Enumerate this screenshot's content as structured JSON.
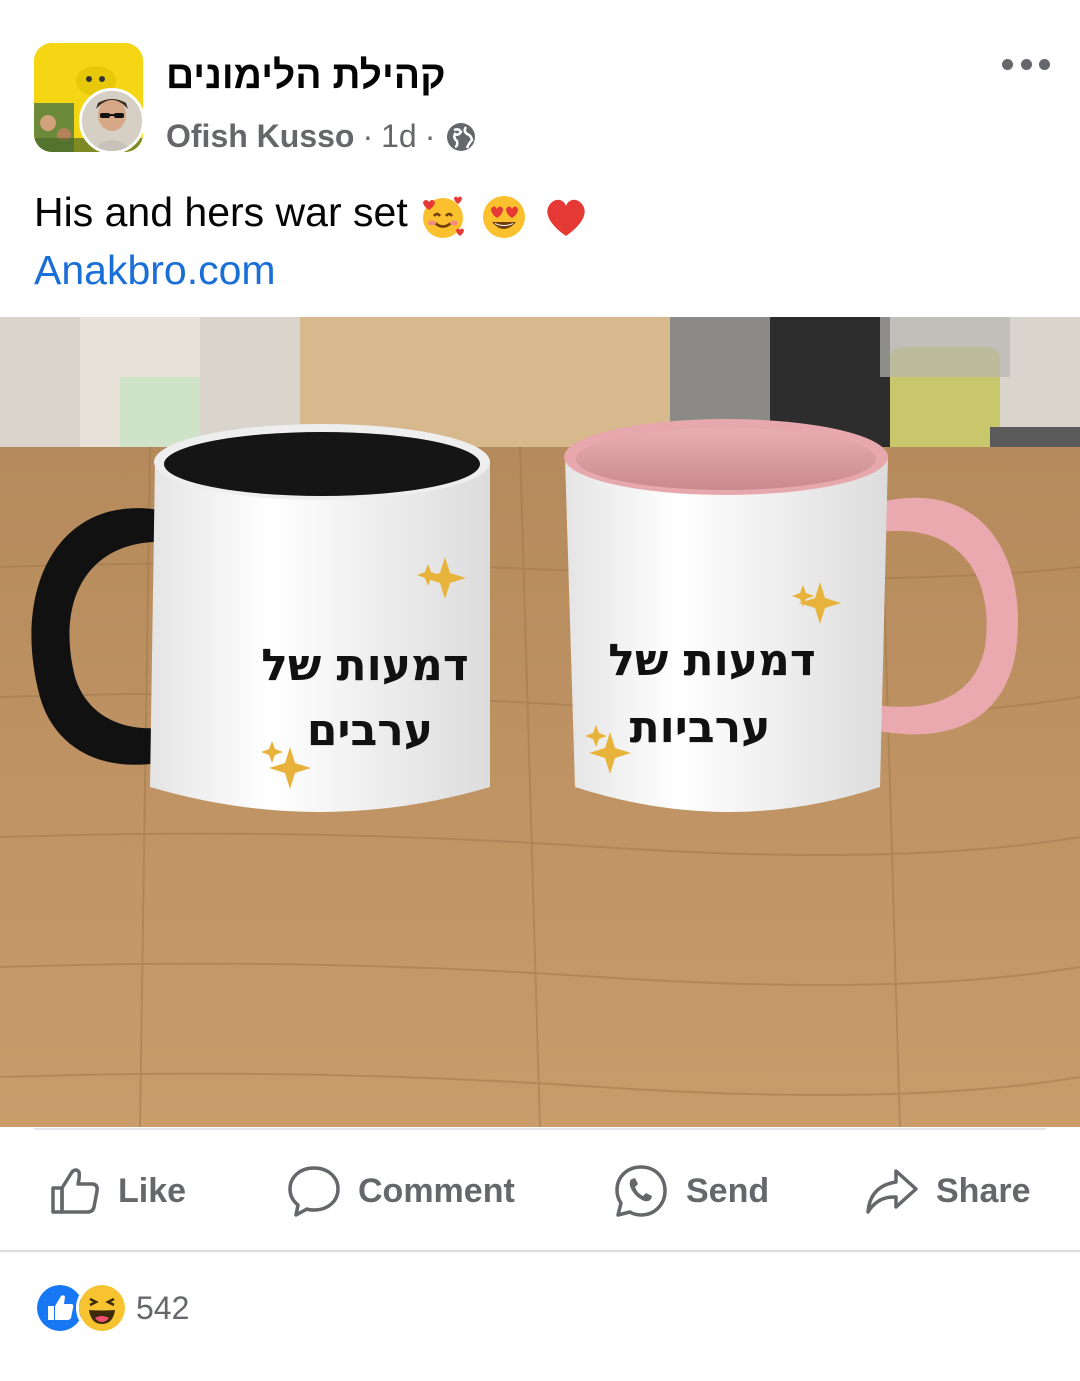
{
  "post": {
    "group_name": "קהילת הלימונים",
    "author": "Ofish Kusso",
    "time": "1d",
    "separator": "·",
    "privacy_icon": "globe-icon",
    "text": "His and hers war set",
    "text_emojis": [
      "smiling-face-with-hearts",
      "heart-eyes",
      "red-heart"
    ],
    "link": "Anakbro.com"
  },
  "photo": {
    "mug_left_text_line1": "דמעות של",
    "mug_left_text_line2": "ערבים",
    "mug_right_text_line1": "דמעות של",
    "mug_right_text_line2": "ערביות"
  },
  "actions": {
    "like": "Like",
    "comment": "Comment",
    "send": "Send",
    "share": "Share"
  },
  "reactions": {
    "icons": [
      "like-reaction-icon",
      "haha-reaction-icon"
    ],
    "count": "542"
  },
  "colors": {
    "secondary_text": "#65676b",
    "link": "#1a6ed8",
    "like_blue": "#1877f2",
    "group_avatar_yellow": "#f4d614"
  }
}
